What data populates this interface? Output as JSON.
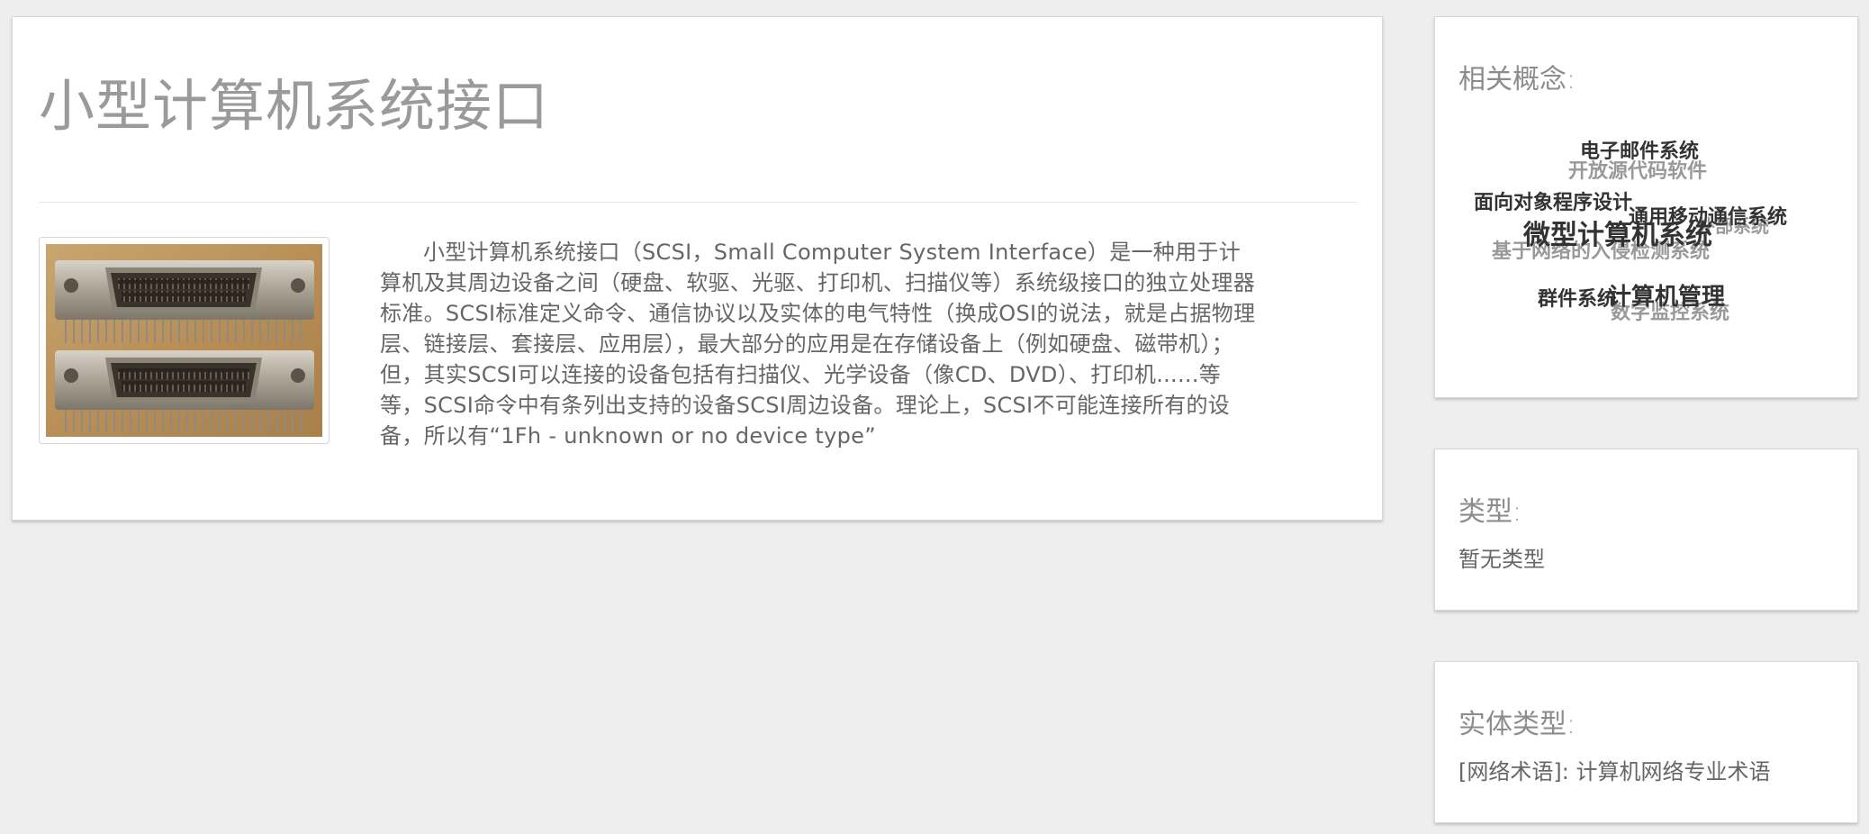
{
  "title": "小型计算机系统接口",
  "image_alt": "SCSI connector photo",
  "description": "小型计算机系统接口（SCSI，Small Computer System Interface）是一种用于计算机及其周边设备之间（硬盘、软驱、光驱、打印机、扫描仪等）系统级接口的独立处理器标准。SCSI标准定义命令、通信协议以及实体的电气特性（换成OSI的说法，就是占据物理层、链接层、套接层、应用层），最大部分的应用是在存储设备上（例如硬盘、磁带机）；但，其实SCSI可以连接的设备包括有扫描仪、光学设备（像CD、DVD）、打印机......等等，SCSI命令中有条列出支持的设备SCSI周边设备。理论上，SCSI不可能连接所有的设备，所以有“1Fh - unknown or no device type”",
  "related": {
    "heading": "相关概念:",
    "words": [
      "电子邮件系统",
      "开放源代码软件",
      "面向对象程序设计",
      "通用移动通信系统",
      "外部系统",
      "微型计算机系统",
      "基于网络的入侵检测系统",
      "群件系统",
      "计算机管理",
      "数字监控系统"
    ]
  },
  "type_card": {
    "heading": "类型:",
    "value": "暂无类型"
  },
  "entity_card": {
    "heading": "实体类型:",
    "value": "[网络术语]: 计算机网络专业术语"
  },
  "colors": {
    "background": "#eeeeee",
    "card": "#ffffff",
    "title_gray": "#9a9a9a",
    "text_gray": "#666666",
    "word_dark": "#333333",
    "word_light": "#999999"
  }
}
